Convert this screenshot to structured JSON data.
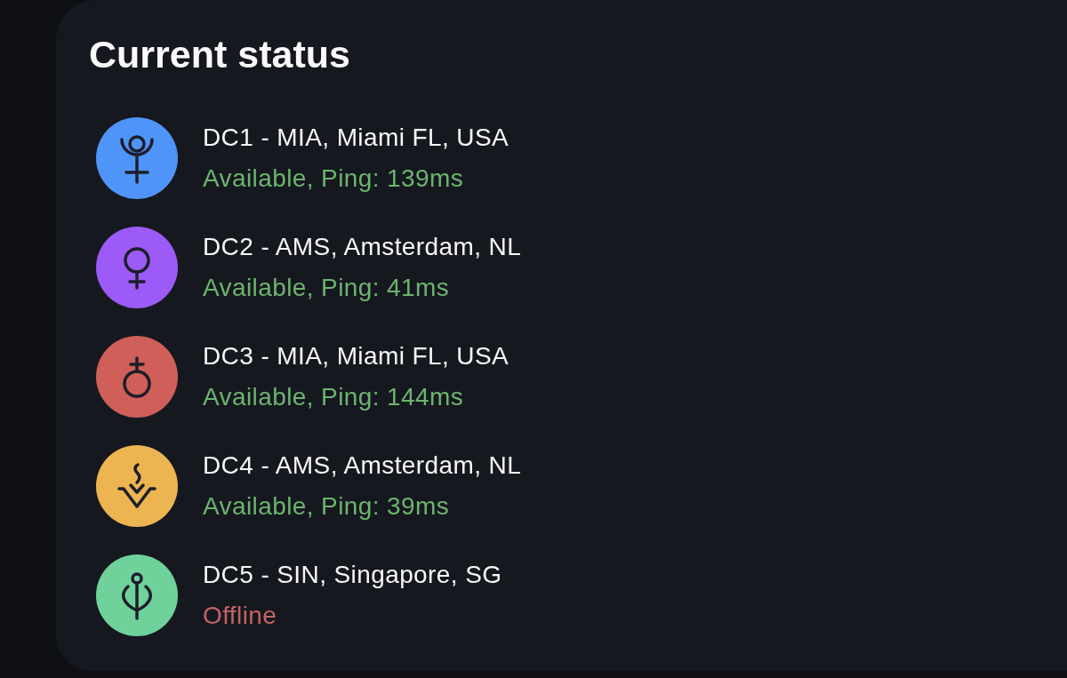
{
  "panel": {
    "title": "Current status",
    "datacenters": [
      {
        "name": "DC1 - MIA, Miami FL, USA",
        "status": "Available, Ping: 139ms",
        "available": true,
        "color": "#4f94f8"
      },
      {
        "name": "DC2 - AMS, Amsterdam, NL",
        "status": "Available, Ping: 41ms",
        "available": true,
        "color": "#9c5af6"
      },
      {
        "name": "DC3 - MIA, Miami FL, USA",
        "status": "Available, Ping: 144ms",
        "available": true,
        "color": "#cf5f58"
      },
      {
        "name": "DC4 - AMS, Amsterdam, NL",
        "status": "Available, Ping: 39ms",
        "available": true,
        "color": "#ecb552"
      },
      {
        "name": "DC5 - SIN, Singapore, SG",
        "status": "Offline",
        "available": false,
        "color": "#6fd29b"
      }
    ]
  }
}
